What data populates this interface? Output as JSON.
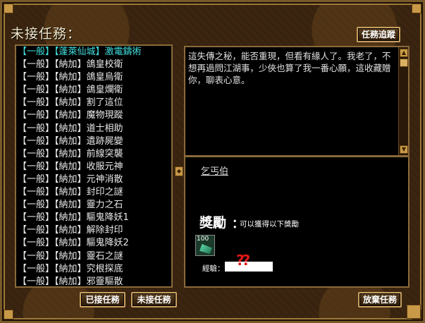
{
  "window": {
    "title": "未接任務：",
    "track_button": "任務追蹤",
    "accepted_button": "已接任務",
    "notaccepted_button": "未接任務",
    "abandon_button": "放棄任務"
  },
  "quests": [
    {
      "label": "【一般】【蓬萊仙城】激電鑄術",
      "selected": true
    },
    {
      "label": "【一般】【納加】鴿皇校衛"
    },
    {
      "label": "【一般】【納加】鴿皇烏衛"
    },
    {
      "label": "【一般】【納加】鴿皇爛衛"
    },
    {
      "label": "【一般】【納加】割了這位"
    },
    {
      "label": "【一般】【納加】魔物現蹤"
    },
    {
      "label": "【一般】【納加】道士相助"
    },
    {
      "label": "【一般】【納加】遺跡屍變"
    },
    {
      "label": "【一般】【納加】前線突襲"
    },
    {
      "label": "【一般】【納加】收服元神"
    },
    {
      "label": "【一般】【納加】元神消散"
    },
    {
      "label": "【一般】【納加】封印之謎"
    },
    {
      "label": "【一般】【納加】靈力之石"
    },
    {
      "label": "【一般】【納加】驅鬼降妖1"
    },
    {
      "label": "【一般】【納加】解除封印"
    },
    {
      "label": "【一般】【納加】驅鬼降妖2"
    },
    {
      "label": "【一般】【納加】靈石之謎"
    },
    {
      "label": "【一般】【納加】究根探底"
    },
    {
      "label": "【一般】【納加】邪靈驅散"
    }
  ],
  "detail": {
    "description": "這失傳之秘，能否重現，但看有緣人了。我老了，不想再過問江湖事，少俠也算了我一番心願，這收藏贈你，聊表心意。",
    "npc": "乞丐伯",
    "reward_title": "獎勵",
    "reward_colon": "：",
    "reward_subtitle": "可以獲得以下獎勵",
    "reward_item_qty": "100",
    "exp_label": "經驗：",
    "exp_marks": "??"
  }
}
